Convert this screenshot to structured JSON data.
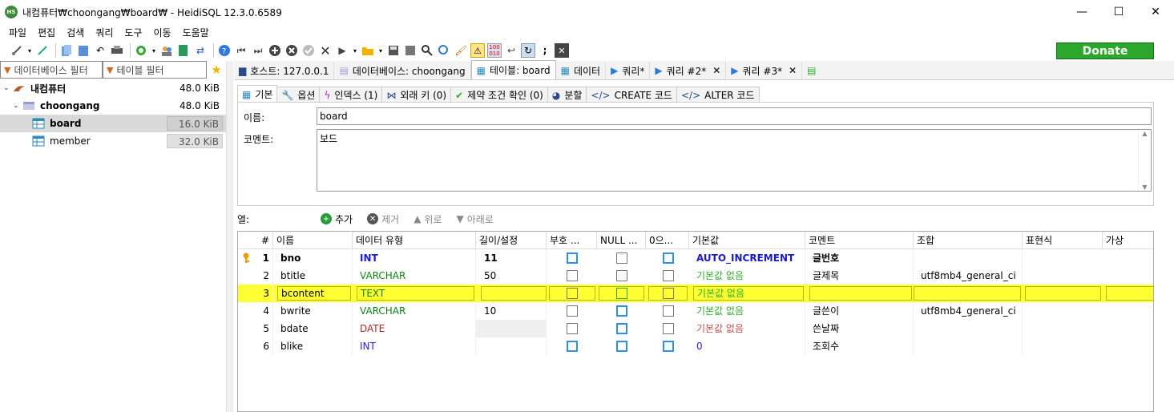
{
  "window": {
    "title": "내컴퓨터₩choongang₩board₩ - HeidiSQL 12.3.0.6589",
    "app_icon_text": "HS",
    "minimize": "—",
    "maximize": "☐",
    "close": "✕"
  },
  "menu": [
    "파일",
    "편집",
    "검색",
    "쿼리",
    "도구",
    "이동",
    "도움말"
  ],
  "donate_label": "Donate",
  "filters": {
    "db_filter_placeholder": "데이터베이스 필터",
    "table_filter_placeholder": "테이블 필터"
  },
  "tree": {
    "root": {
      "label": "내컴퓨터",
      "size": "48.0 KiB"
    },
    "db": {
      "label": "choongang",
      "size": "48.0 KiB"
    },
    "tables": [
      {
        "label": "board",
        "size": "16.0 KiB"
      },
      {
        "label": "member",
        "size": "32.0 KiB"
      }
    ]
  },
  "main_tabs": [
    {
      "label": "호스트: 127.0.0.1"
    },
    {
      "label": "데이터베이스: choongang"
    },
    {
      "label": "테이블: board"
    },
    {
      "label": "데이터"
    },
    {
      "label": "쿼리*"
    },
    {
      "label": "쿼리 #2*"
    },
    {
      "label": "쿼리 #3*"
    }
  ],
  "sub_tabs": [
    {
      "label": "기본"
    },
    {
      "label": "옵션"
    },
    {
      "label": "인덱스 (1)"
    },
    {
      "label": "외래 키 (0)"
    },
    {
      "label": "제약 조건 확인 (0)"
    },
    {
      "label": "분할"
    },
    {
      "label": "CREATE 코드"
    },
    {
      "label": "ALTER 코드"
    }
  ],
  "form": {
    "name_label": "이름:",
    "name_value": "board",
    "comment_label": "코멘트:",
    "comment_value": "보드"
  },
  "columns_toolbar": {
    "label": "열:",
    "add": "추가",
    "remove": "제거",
    "up": "위로",
    "down": "아래로"
  },
  "grid": {
    "headers": [
      "#",
      "이름",
      "데이터 유형",
      "길이/설정",
      "부호 ...",
      "NULL ...",
      "0으...",
      "기본값",
      "코멘트",
      "조합",
      "표현식",
      "가상"
    ],
    "rows": [
      {
        "n": "1",
        "name": "bno",
        "type": "INT",
        "len": "11",
        "default": "AUTO_INCREMENT",
        "comment": "글번호",
        "collation": ""
      },
      {
        "n": "2",
        "name": "btitle",
        "type": "VARCHAR",
        "len": "50",
        "default": "기본값 없음",
        "comment": "글제목",
        "collation": "utf8mb4_general_ci"
      },
      {
        "n": "3",
        "name": "bcontent",
        "type": "TEXT",
        "len": "",
        "default": "기본값 없음",
        "comment": "",
        "collation": ""
      },
      {
        "n": "4",
        "name": "bwrite",
        "type": "VARCHAR",
        "len": "10",
        "default": "기본값 없음",
        "comment": "글쓴이",
        "collation": "utf8mb4_general_ci"
      },
      {
        "n": "5",
        "name": "bdate",
        "type": "DATE",
        "len": "",
        "default": "기본값 없음",
        "comment": "쓴날짜",
        "collation": ""
      },
      {
        "n": "6",
        "name": "blike",
        "type": "INT",
        "len": "",
        "default": "0",
        "comment": "조회수",
        "collation": ""
      }
    ]
  }
}
